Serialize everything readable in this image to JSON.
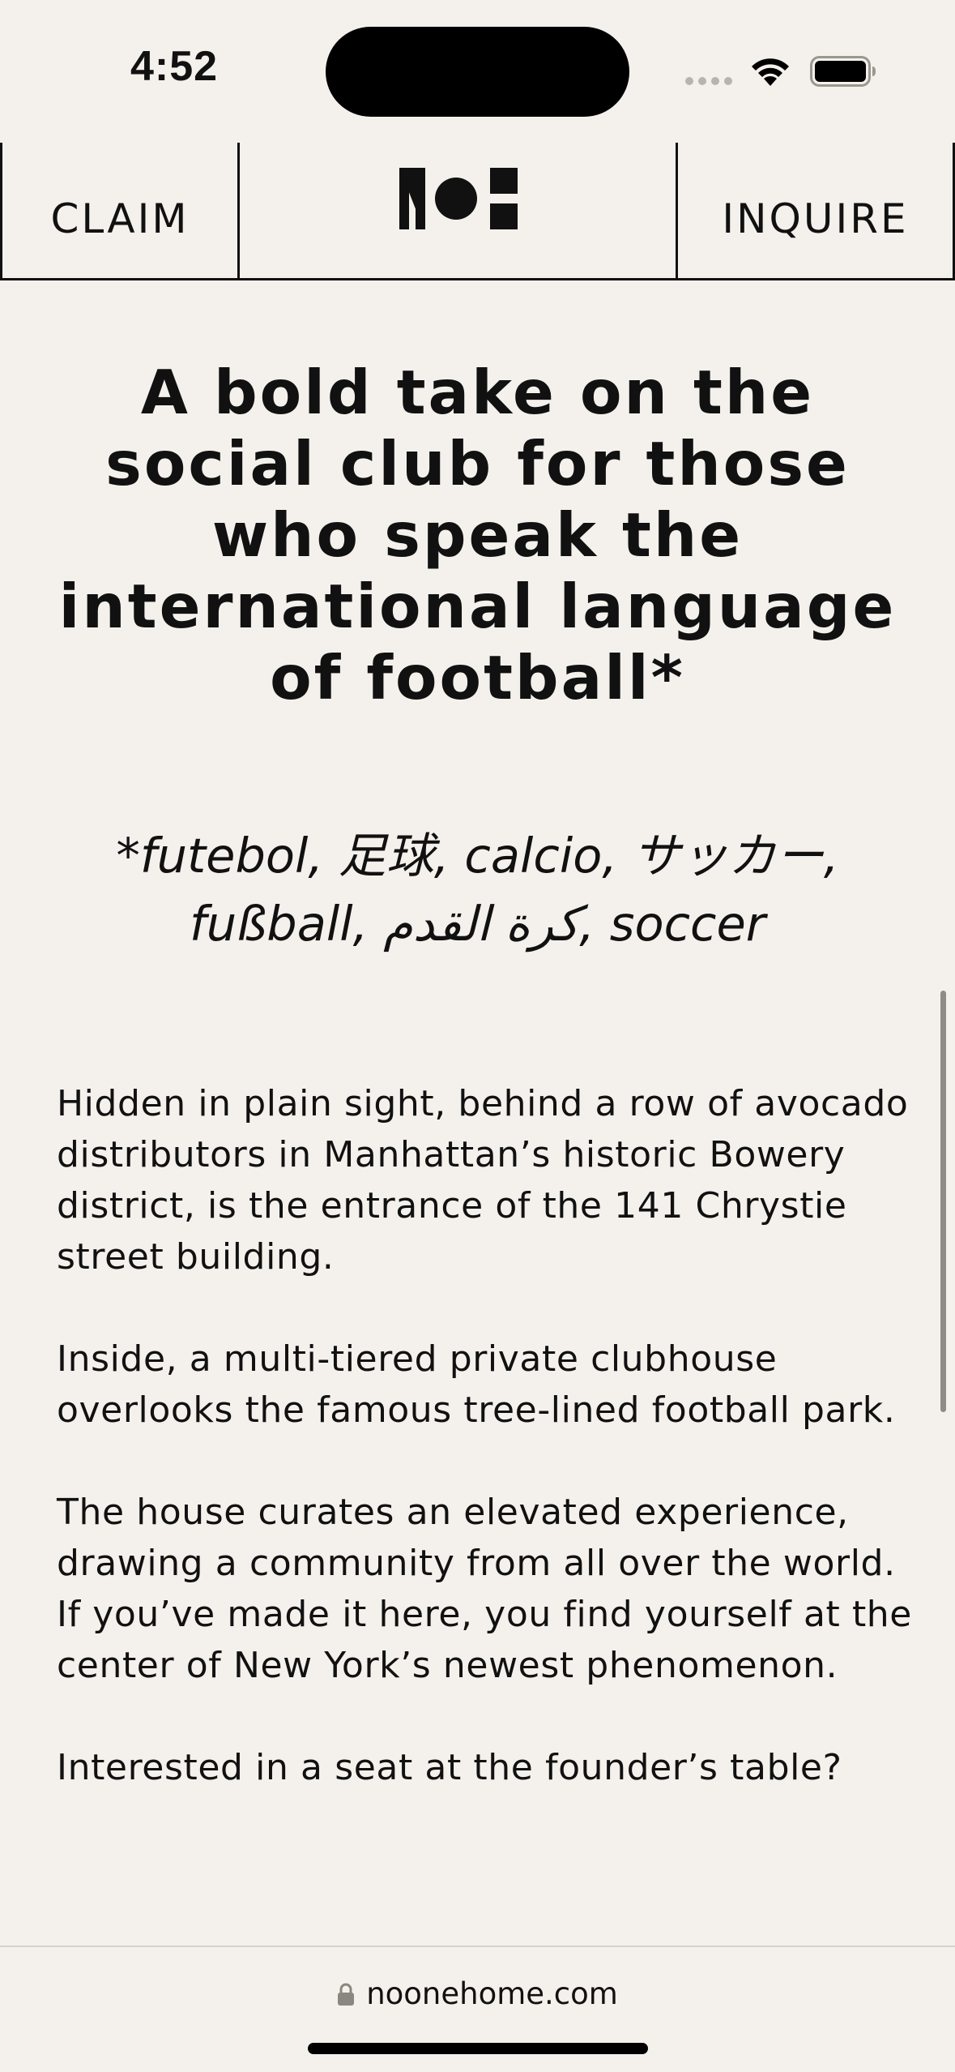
{
  "status_bar": {
    "time": "4:52"
  },
  "nav": {
    "claim_label": "CLAIM",
    "inquire_label": "INQUIRE"
  },
  "headline": "A bold take on the social club for those who speak the international language of football*",
  "footnote": "*futebol, 足球, calcio, サッカー, fußball, كرة القدم, soccer",
  "paragraphs": [
    "Hidden in plain sight, behind a row of avocado distributors in Manhattan’s historic Bowery district, is the entrance of the 141 Chrystie street building.",
    "Inside, a multi-tiered private clubhouse overlooks the famous tree-lined football park.",
    "The house curates an elevated experience, drawing a community from all over the world. If you’ve made it here, you find yourself at the center of New York’s newest phenomenon.",
    "Interested in a seat at the founder’s table?"
  ],
  "browser": {
    "url": "noonehome.com"
  },
  "colors": {
    "background": "#f4f1ec",
    "text": "#111111"
  },
  "icons": [
    "wifi-icon",
    "battery-icon",
    "brand-logo",
    "lock-icon"
  ]
}
